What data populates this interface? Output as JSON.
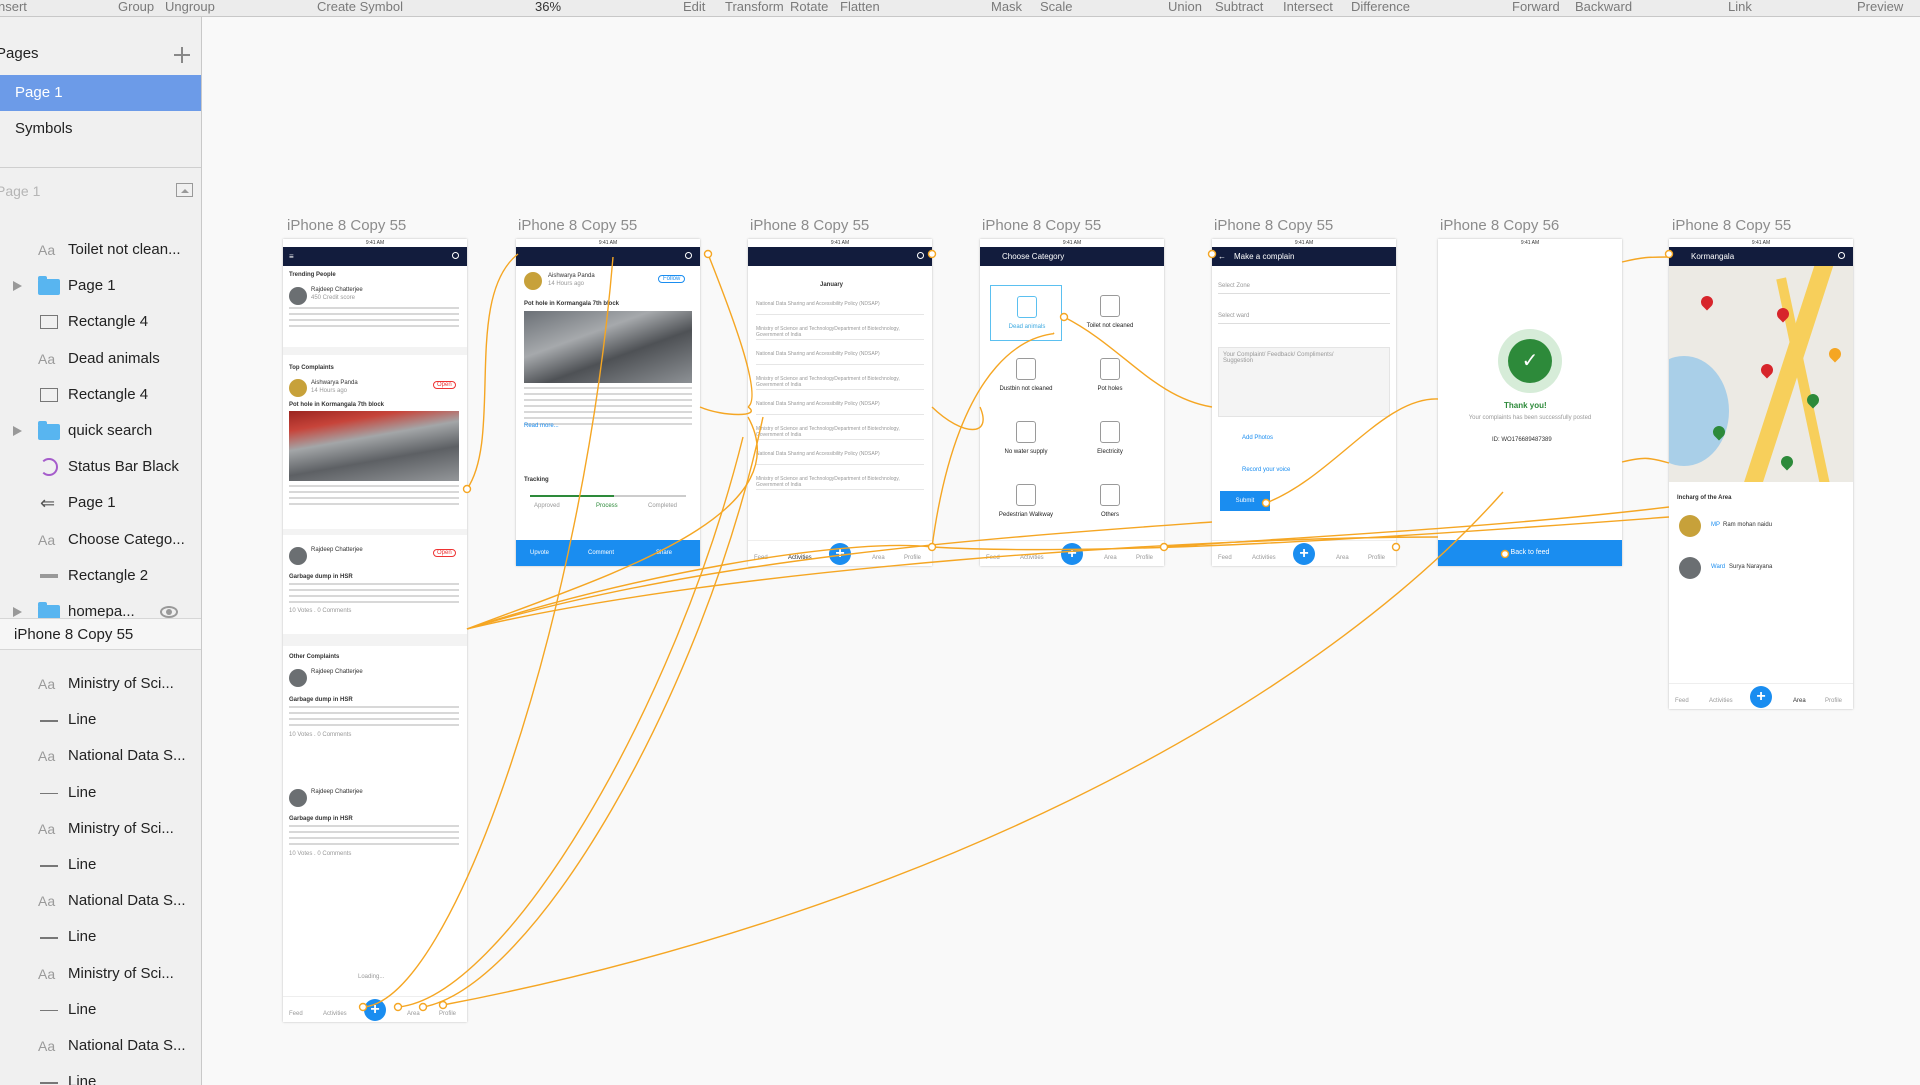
{
  "toolbar": {
    "items": [
      "nsert",
      "Group",
      "Ungroup",
      "Create Symbol",
      "36%",
      "Edit",
      "Transform",
      "Rotate",
      "Flatten",
      "Mask",
      "Scale",
      "Union",
      "Subtract",
      "Intersect",
      "Difference",
      "Forward",
      "Backward",
      "Link",
      "Preview"
    ]
  },
  "sidebar": {
    "pages_title": "Pages",
    "pages": [
      "Page 1",
      "Symbols"
    ],
    "layers_title": "Page 1",
    "layers": [
      {
        "icon": "text-icon",
        "label": "Toilet not clean..."
      },
      {
        "icon": "folder-icon",
        "label": "Page 1",
        "expand": true
      },
      {
        "icon": "rectangle-icon",
        "label": "Rectangle 4"
      },
      {
        "icon": "text-icon",
        "label": "Dead animals"
      },
      {
        "icon": "rectangle-hotspot-icon",
        "label": "Rectangle 4"
      },
      {
        "icon": "folder-icon",
        "label": "quick search",
        "expand": true
      },
      {
        "icon": "symbol-icon",
        "label": "Status Bar Black"
      },
      {
        "icon": "hotspot-icon",
        "label": "Page 1"
      },
      {
        "icon": "text-icon",
        "label": "Choose Catego..."
      },
      {
        "icon": "line-icon",
        "label": "Rectangle 2"
      },
      {
        "icon": "folder-icon",
        "label": "homepa...",
        "expand": true,
        "eye": true
      }
    ],
    "artboard_group": "iPhone 8 Copy 55",
    "artboard_layers": [
      {
        "icon": "text-icon",
        "label": "Ministry of Sci..."
      },
      {
        "icon": "line-icon",
        "label": "Line"
      },
      {
        "icon": "text-icon",
        "label": "National Data S..."
      },
      {
        "icon": "line-icon",
        "label": "Line"
      },
      {
        "icon": "text-icon",
        "label": "Ministry of Sci..."
      },
      {
        "icon": "line-icon",
        "label": "Line"
      },
      {
        "icon": "text-icon",
        "label": "National Data S..."
      },
      {
        "icon": "line-icon",
        "label": "Line"
      },
      {
        "icon": "text-icon",
        "label": "Ministry of Sci..."
      },
      {
        "icon": "line-icon",
        "label": "Line"
      },
      {
        "icon": "text-icon",
        "label": "National Data S..."
      },
      {
        "icon": "line-icon",
        "label": "Line"
      }
    ]
  },
  "artboards": [
    {
      "title": "iPhone 8 Copy 55"
    },
    {
      "title": "iPhone 8 Copy 55"
    },
    {
      "title": "iPhone 8 Copy 55"
    },
    {
      "title": "iPhone 8 Copy 55"
    },
    {
      "title": "iPhone 8 Copy 55"
    },
    {
      "title": "iPhone 8 Copy 56"
    },
    {
      "title": "iPhone 8 Copy 55"
    }
  ],
  "feed": {
    "time": "9:41 AM",
    "trending": "Trending People",
    "person": "Rajdeep Chatterjee",
    "credit": "450 Credit score",
    "top": "Top Complaints",
    "person2": "Aishwarya Panda",
    "ago": "14 Hours ago",
    "badge": "Open",
    "post1": "Pot hole in Kormangala 7th block",
    "post2": "Garbage dump in HSR",
    "other": "Other Complaints",
    "votes": "10 Votes . 0 Comments",
    "loading": "Loading...",
    "tabs": [
      "Feed",
      "Activities",
      "Area",
      "Profile"
    ]
  },
  "detail": {
    "name": "Aishwarya Panda",
    "ago": "14 Hours ago",
    "follow": "Follow",
    "title": "Pot hole in Kormangala 7th block",
    "readmore": "Read more...",
    "tracking": "Tracking",
    "steps": [
      "Approved",
      "Process",
      "Completed"
    ],
    "actions": [
      "Upvote",
      "Comment",
      "Share"
    ]
  },
  "activities": {
    "month": "January",
    "items": [
      "National Data Sharing and Accessibility Policy (NDSAP)",
      "Ministry of Science and TechnologyDepartment of Biotechnology, Government of India",
      "National Data Sharing and Accessibility Policy (NDSAP)",
      "Ministry of Science and TechnologyDepartment of Biotechnology, Government of India",
      "National Data Sharing and Accessibility Policy (NDSAP)",
      "Ministry of Science and TechnologyDepartment of Biotechnology, Government of India",
      "National Data Sharing and Accessibility Policy (NDSAP)",
      "Ministry of Science and TechnologyDepartment of Biotechnology, Government of India"
    ]
  },
  "category": {
    "title": "Choose Category",
    "items": [
      "Dead animals",
      "Toilet not cleaned",
      "Dustbin not cleaned",
      "Pot holes",
      "No water supply",
      "Electricity",
      "Pedestrian Walkway",
      "Others"
    ]
  },
  "complain": {
    "title": "Make a complain",
    "zone": "Select Zone",
    "ward": "Select ward",
    "text": "Your Complaint/ Feedback/ Compliments/ Suggestion",
    "photos": "Add Photos",
    "voice": "Record your voice",
    "submit": "Submit"
  },
  "thanks": {
    "title": "Thank you!",
    "msg": "Your complaints has been successfully posted",
    "id": "ID: WO176689487389",
    "back": "Back to feed"
  },
  "area": {
    "title": "Kormangala",
    "incharge": "Incharg of the Area",
    "mp_role": "MP",
    "mp_name": "Ram mohan naidu",
    "ward_role": "Ward",
    "ward_name": "Surya Narayana",
    "tabs": [
      "Feed",
      "Activities",
      "Area",
      "Profile"
    ]
  },
  "colors": {
    "accent": "#1a8df0",
    "navy": "#121c3d",
    "wire": "#f5a623",
    "selection": "#6c9be8"
  }
}
